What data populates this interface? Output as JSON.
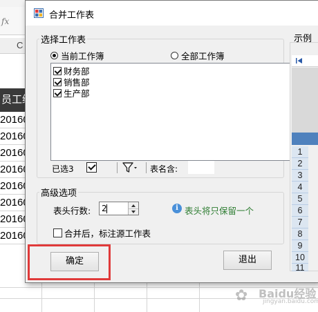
{
  "spreadsheet": {
    "formula_bar_fx": "fx",
    "column_letter": "C",
    "header_cell": "员工编",
    "data_cells": [
      "20160",
      "20160",
      "20160",
      "20160",
      "20160",
      "20160",
      "20160",
      "20160"
    ]
  },
  "dialog": {
    "title": "合并工作表",
    "select_group": {
      "legend": "选择工作表",
      "radio_current": "当前工作簿",
      "radio_all": "全部工作簿",
      "selected_radio": "current",
      "sheets": [
        {
          "label": "财务部",
          "checked": true
        },
        {
          "label": "销售部",
          "checked": true
        },
        {
          "label": "生产部",
          "checked": true
        }
      ],
      "selected_count_label": "已选3",
      "sheet_name_filter_label": "表名含:",
      "sheet_name_filter_value": ""
    },
    "advanced_group": {
      "legend": "高级选项",
      "header_rows_label": "表头行数:",
      "header_rows_value": "2",
      "hint": "表头将只保留一个",
      "mark_source_label": "合并后，标注源工作表",
      "mark_source_checked": false
    },
    "ok_button": "确定",
    "exit_button": "退出",
    "example": {
      "title": "示例",
      "row_numbers": [
        "1",
        "2",
        "3",
        "4",
        "5",
        "6",
        "7",
        "8",
        "9",
        "10",
        "11",
        "12",
        "13"
      ]
    }
  },
  "colors": {
    "highlight": "#e03a3a",
    "hint_text": "#2e7d32",
    "example_row_header": "#dce6f1",
    "example_header": "#4f81bd"
  },
  "watermark": {
    "brand": "Baidu经验",
    "sub": "jingyan.baidu.com"
  }
}
